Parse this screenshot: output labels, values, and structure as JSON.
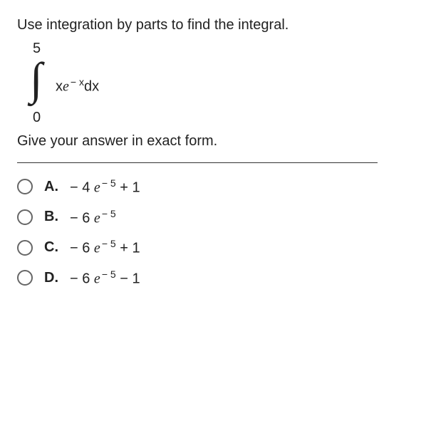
{
  "question": {
    "line1": "Use integration by parts to find the integral.",
    "integral": {
      "upper": "5",
      "lower": "0",
      "integrand_x1": "x",
      "integrand_e": "e",
      "exp": "− x",
      "dx": "dx"
    },
    "line2": "Give your answer in exact form."
  },
  "choices": [
    {
      "letter": "A.",
      "prefix": "− 4 ",
      "e": "e",
      "exp": "− 5",
      "suffix": " + 1"
    },
    {
      "letter": "B.",
      "prefix": "− 6 ",
      "e": "e",
      "exp": "− 5",
      "suffix": ""
    },
    {
      "letter": "C.",
      "prefix": "− 6 ",
      "e": "e",
      "exp": "− 5",
      "suffix": " + 1"
    },
    {
      "letter": "D.",
      "prefix": "− 6 ",
      "e": "e",
      "exp": "− 5",
      "suffix": " − 1"
    }
  ]
}
